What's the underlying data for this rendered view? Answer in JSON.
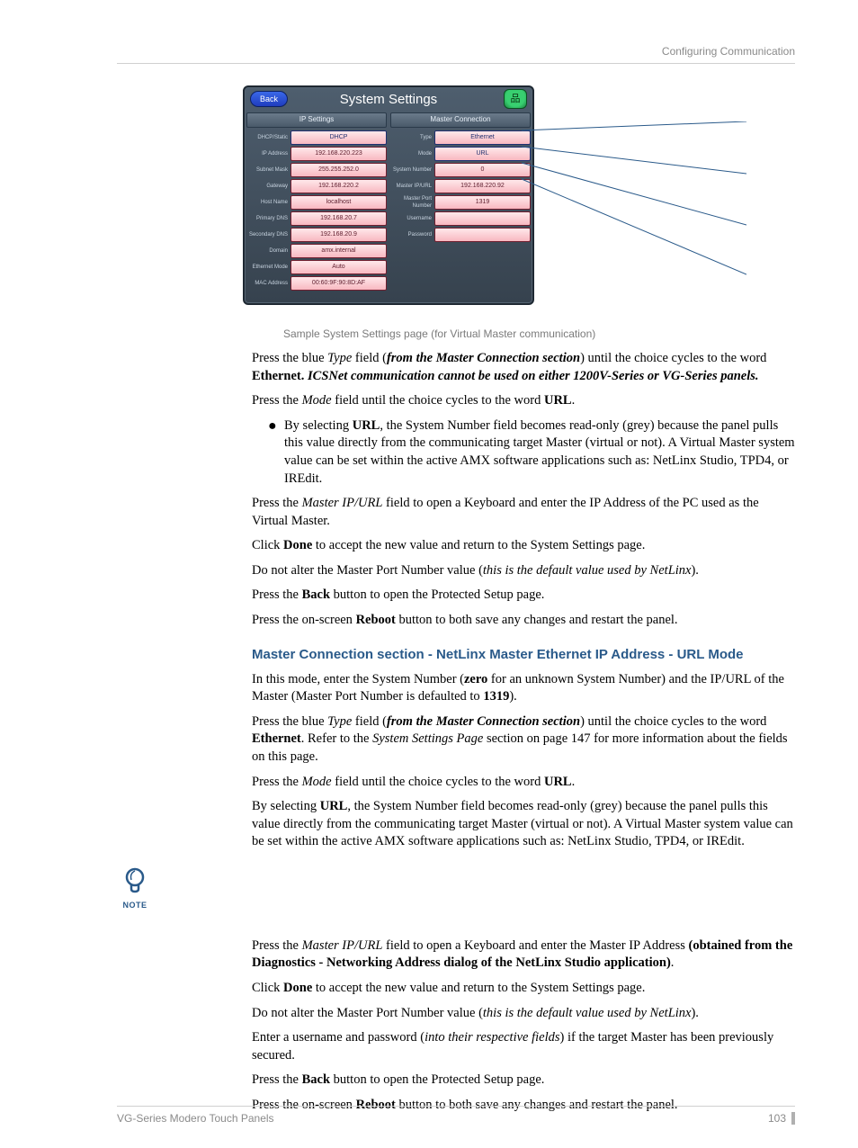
{
  "header": {
    "running": "Configuring Communication"
  },
  "figure": {
    "title": "System Settings",
    "back": "Back",
    "col_left": "IP Settings",
    "col_right": "Master Connection",
    "left_rows": [
      {
        "label": "DHCP/Static",
        "value": "DHCP",
        "cls": "blue"
      },
      {
        "label": "IP Address",
        "value": "192.168.220.223"
      },
      {
        "label": "Subnet Mask",
        "value": "255.255.252.0"
      },
      {
        "label": "Gateway",
        "value": "192.168.220.2"
      },
      {
        "label": "Host Name",
        "value": "localhost"
      },
      {
        "label": "Primary DNS",
        "value": "192.168.20.7"
      },
      {
        "label": "Secondary DNS",
        "value": "192.168.20.9"
      },
      {
        "label": "Domain",
        "value": "amx.internal"
      },
      {
        "label": "Ethernet Mode",
        "value": "Auto"
      },
      {
        "label": "MAC Address",
        "value": "00:60:9F:90:8D:AF"
      }
    ],
    "right_rows": [
      {
        "label": "Type",
        "value": "Ethernet",
        "cls": "blue"
      },
      {
        "label": "Mode",
        "value": "URL",
        "cls": "blue"
      },
      {
        "label": "System Number",
        "value": "0"
      },
      {
        "label": "Master IP/URL",
        "value": "192.168.220.92"
      },
      {
        "label": "Master Port Number",
        "value": "1319"
      },
      {
        "label": "Username",
        "value": ""
      },
      {
        "label": "Password",
        "value": ""
      }
    ],
    "caption": "Sample System Settings page (for Virtual Master communication)"
  },
  "body": {
    "p1a": "Press the blue ",
    "p1b": "Type",
    "p1c": " field (",
    "p1d": "from the Master Connection section",
    "p1e": ") until the choice cycles to the word ",
    "p1f": "Ethernet.",
    "p1g": " ICSNet communication cannot be used on either 1200V-Series or VG-Series panels.",
    "p2a": "Press the ",
    "p2b": "Mode",
    "p2c": " field until the choice cycles to the word ",
    "p2d": "URL",
    "p2e": ".",
    "bul_a": "By selecting ",
    "bul_b": "URL",
    "bul_c": ", the System Number field becomes read-only (grey) because the panel pulls this value directly from the communicating target Master (virtual or not). A Virtual Master system value can be set within the active AMX software applications such as: NetLinx Studio, TPD4, or IREdit.",
    "p3a": "Press the ",
    "p3b": "Master IP/URL",
    "p3c": " field to open a Keyboard and enter the IP Address of the PC used as the Virtual Master.",
    "p4a": "Click ",
    "p4b": "Done",
    "p4c": " to accept the new value and return to the System Settings page.",
    "p5a": "Do not alter the Master Port Number value (",
    "p5b": "this is the default value used by NetLinx",
    "p5c": ").",
    "p6a": "Press the ",
    "p6b": "Back",
    "p6c": " button to open the Protected Setup page.",
    "p7a": "Press the on-screen ",
    "p7b": "Reboot",
    "p7c": " button to both save any changes and restart the panel.",
    "h3": "Master Connection section - NetLinx Master Ethernet IP Address - URL Mode",
    "p8a": "In this mode, enter the System Number (",
    "p8b": "zero",
    "p8c": " for an unknown System Number) and the IP/URL of the Master (Master Port Number is defaulted to ",
    "p8d": "1319",
    "p8e": ").",
    "p9a": "Press the blue ",
    "p9b": "Type",
    "p9c": " field (",
    "p9d": "from the Master Connection section",
    "p9e": ") until the choice cycles to the word ",
    "p9f": "Ethernet",
    "p9g": ". Refer to the ",
    "p9h": "System Settings Page",
    "p9i": " section on page 147 for more information about the fields on this page.",
    "p10a": "Press the ",
    "p10b": "Mode",
    "p10c": " field until the choice cycles to the word ",
    "p10d": "URL",
    "p10e": ".",
    "p11a": "By selecting ",
    "p11b": "URL",
    "p11c": ", the System Number field becomes read-only (grey) because the panel pulls this value directly from the communicating target Master (virtual or not). A Virtual Master system value can be set within the active AMX software applications such as: NetLinx Studio, TPD4, or IREdit.",
    "p12a": "Press the ",
    "p12b": "Master IP/URL",
    "p12c": " field to open a Keyboard and enter the Master IP Address ",
    "p12d": "(obtained from the Diagnostics - Networking Address dialog of the NetLinx Studio application)",
    "p12e": ".",
    "p13a": "Click ",
    "p13b": "Done",
    "p13c": " to accept the new value and return to the System Settings page.",
    "p14a": "Do not alter the Master Port Number value (",
    "p14b": "this is the default value used by NetLinx",
    "p14c": ").",
    "p15a": "Enter a username and password (",
    "p15b": "into their respective fields",
    "p15c": ") if the target Master has been previously secured.",
    "p16a": "Press the ",
    "p16b": "Back",
    "p16c": " button to open the Protected Setup page.",
    "p17a": "Press the on-screen ",
    "p17b": "Reboot",
    "p17c": " button to both save any changes and restart the panel."
  },
  "note": {
    "label": "NOTE"
  },
  "footer": {
    "title": "VG-Series Modero Touch Panels",
    "page": "103"
  }
}
